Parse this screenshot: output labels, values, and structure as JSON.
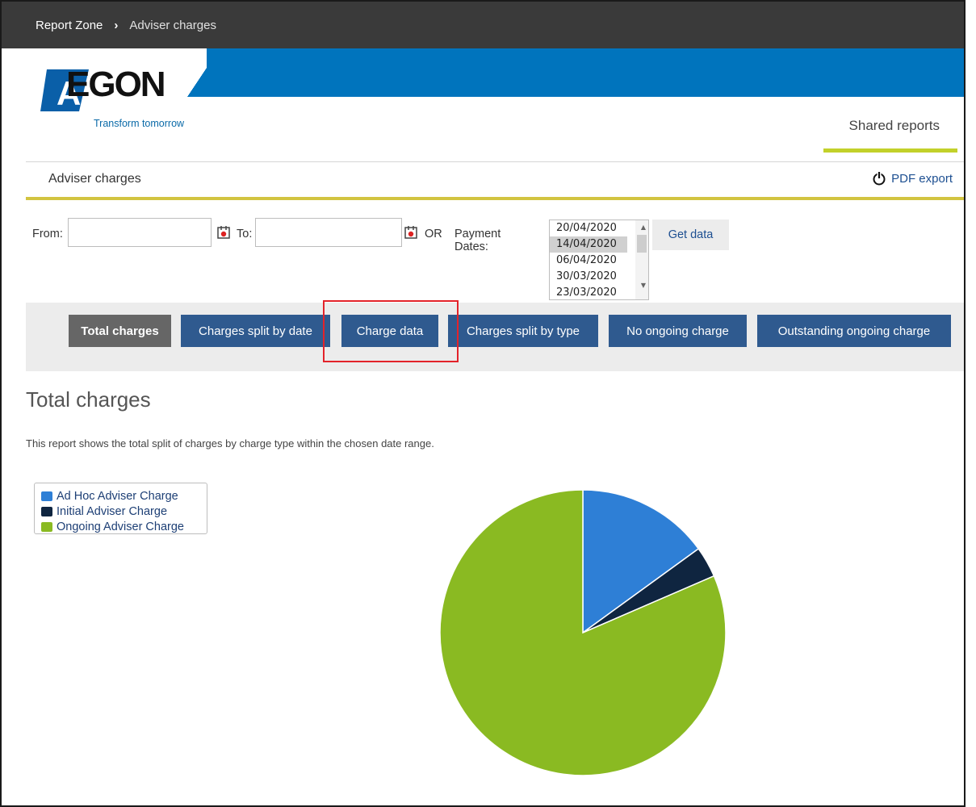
{
  "breadcrumb": {
    "root": "Report Zone",
    "separator": "›",
    "current": "Adviser charges"
  },
  "brand": {
    "logo_text": "EGON",
    "logo_mark_letter": "A",
    "tagline": "Transform tomorrow",
    "colors": {
      "blue": "#0074bd",
      "accent_green": "#c2d12a"
    }
  },
  "nav": {
    "shared_reports": "Shared reports"
  },
  "section": {
    "title": "Adviser charges",
    "pdf_export": "PDF export"
  },
  "filters": {
    "from_label": "From:",
    "from_value": "",
    "to_label": "To:",
    "to_value": "",
    "or_label": "OR",
    "payment_dates_label": "Payment Dates:",
    "payment_dates": [
      "20/04/2020",
      "14/04/2020",
      "06/04/2020",
      "30/03/2020",
      "23/03/2020"
    ],
    "selected_date": "14/04/2020",
    "get_data": "Get data"
  },
  "tabs": [
    {
      "label": "Total charges",
      "active": true
    },
    {
      "label": "Charges split by date",
      "active": false
    },
    {
      "label": "Charge data",
      "active": false
    },
    {
      "label": "Charges split by type",
      "active": false
    },
    {
      "label": "No ongoing charge",
      "active": false
    },
    {
      "label": "Outstanding ongoing charge",
      "active": false
    }
  ],
  "report": {
    "title": "Total charges",
    "description": "This report shows the total split of charges by charge type within the chosen date range."
  },
  "chart_data": {
    "type": "pie",
    "title": "",
    "legend_position": "top-left",
    "categories": [
      "Ad Hoc Adviser Charge",
      "Initial Adviser Charge",
      "Ongoing Adviser Charge"
    ],
    "values": [
      15,
      3.5,
      81.5
    ],
    "colors": [
      "#2e7fd6",
      "#0f2540",
      "#8aba22"
    ]
  }
}
